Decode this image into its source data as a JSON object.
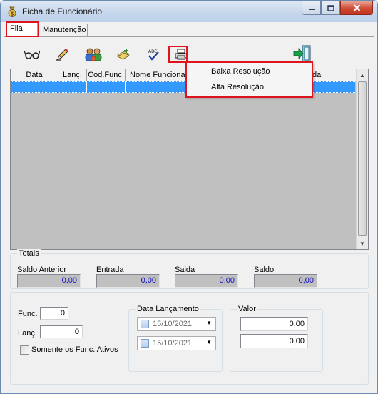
{
  "window": {
    "title": "Ficha de Funcionário"
  },
  "tabs": [
    {
      "label": "Fila"
    },
    {
      "label": "Manutenção"
    }
  ],
  "toolbar": {
    "buttons": [
      {
        "icon": "glasses-icon"
      },
      {
        "icon": "edit-pencil-icon"
      },
      {
        "icon": "users-icon"
      },
      {
        "icon": "add-record-icon"
      },
      {
        "icon": "spellcheck-icon"
      },
      {
        "icon": "printer-icon"
      },
      {
        "icon": "exit-door-icon"
      }
    ]
  },
  "grid": {
    "columns": [
      "Data",
      "Lanç.",
      "Cod.Func.",
      "Nome Funcionar",
      "ída"
    ]
  },
  "print_menu": {
    "items": [
      "Baixa  Resolução",
      "Alta Resolução"
    ]
  },
  "totals": {
    "legend": "Totais",
    "fields": [
      {
        "label": "Saldo Anterior",
        "value": "0,00"
      },
      {
        "label": "Entrada",
        "value": "0,00"
      },
      {
        "label": "Saida",
        "value": "0,00"
      },
      {
        "label": "Saldo",
        "value": "0,00"
      }
    ]
  },
  "filters": {
    "func_label": "Func.",
    "func_value": "0",
    "lanc_label": "Lanç.",
    "lanc_value": "0",
    "only_active_label": "Somente os Func. Ativos",
    "data_lancamento": {
      "legend": "Data Lançamento",
      "from": "15/10/2021",
      "to": "15/10/2021"
    },
    "valor": {
      "legend": "Valor",
      "from": "0,00",
      "to": "0,00"
    }
  },
  "colors": {
    "highlight": "#e0141e",
    "selected_row": "#3399ff",
    "total_value_text": "#1010c0"
  }
}
